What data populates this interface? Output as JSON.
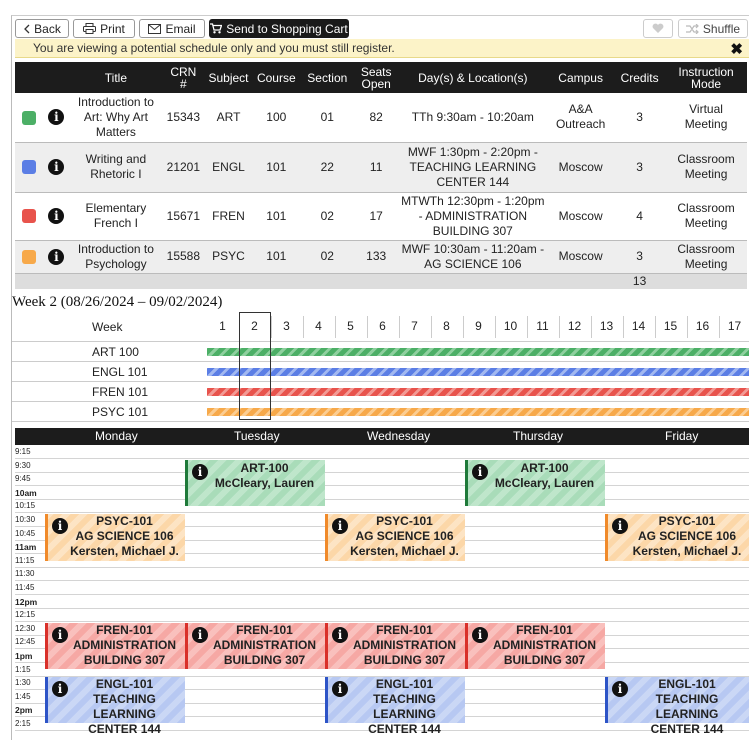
{
  "toolbar": {
    "back": "Back",
    "print": "Print",
    "email": "Email",
    "cart": "Send to Shopping Cart",
    "shuffle": "Shuffle",
    "icons": {
      "back": "chevron-left-icon",
      "print": "printer-icon",
      "email": "envelope-icon",
      "cart": "cart-icon",
      "favorite": "heart-icon",
      "shuffle": "shuffle-icon"
    }
  },
  "notice": {
    "text": "You are viewing a potential schedule only and you must still register.",
    "close": "✖"
  },
  "table": {
    "headers": {
      "title": "Title",
      "crn_a": "CRN",
      "crn_b": "#",
      "subject": "Subject",
      "course": "Course",
      "section": "Section",
      "seats_a": "Seats",
      "seats_b": "Open",
      "days": "Day(s) & Location(s)",
      "campus": "Campus",
      "credits": "Credits",
      "mode_a": "Instruction",
      "mode_b": "Mode"
    },
    "rows": [
      {
        "color": "#4caf66",
        "title": "Introduction to Art: Why Art Matters",
        "crn": "15343",
        "subject": "ART",
        "course": "100",
        "section": "01",
        "seats": "82",
        "days": "TTh 9:30am - 10:20am",
        "campus": "A&A Outreach",
        "credits": "3",
        "mode": "Virtual Meeting"
      },
      {
        "color": "#5b7ee5",
        "title": "Writing and Rhetoric I",
        "crn": "21201",
        "subject": "ENGL",
        "course": "101",
        "section": "22",
        "seats": "11",
        "days": "MWF 1:30pm - 2:20pm - TEACHING LEARNING CENTER 144",
        "campus": "Moscow",
        "credits": "3",
        "mode": "Classroom Meeting"
      },
      {
        "color": "#e8534c",
        "title": "Elementary French I",
        "crn": "15671",
        "subject": "FREN",
        "course": "101",
        "section": "02",
        "seats": "17",
        "days": "MTWTh 12:30pm - 1:20pm - ADMINISTRATION BUILDING 307",
        "campus": "Moscow",
        "credits": "4",
        "mode": "Classroom Meeting"
      },
      {
        "color": "#f7a94a",
        "title": "Introduction to Psychology",
        "crn": "15588",
        "subject": "PSYC",
        "course": "101",
        "section": "02",
        "seats": "133",
        "days": "MWF 10:30am - 11:20am - AG SCIENCE 106",
        "campus": "Moscow",
        "credits": "3",
        "mode": "Classroom Meeting"
      }
    ],
    "total_credits": "13",
    "info_glyph": "i"
  },
  "week_view": {
    "heading": "Week 2 (08/26/2024 – 09/02/2024)",
    "week_label": "Week",
    "weeks": [
      "1",
      "2",
      "3",
      "4",
      "5",
      "6",
      "7",
      "8",
      "9",
      "10",
      "11",
      "12",
      "13",
      "14",
      "15",
      "16",
      "17"
    ],
    "selected_week": "2",
    "courses": [
      {
        "label": "ART 100",
        "color": "#4caf66"
      },
      {
        "label": "ENGL 101",
        "color": "#5b7ee5"
      },
      {
        "label": "FREN 101",
        "color": "#e8534c"
      },
      {
        "label": "PSYC 101",
        "color": "#f7a94a"
      }
    ]
  },
  "calendar": {
    "days": [
      "Monday",
      "Tuesday",
      "Wednesday",
      "Thursday",
      "Friday"
    ],
    "times": [
      "9:15",
      "9:30",
      "9:45",
      "10am",
      "10:15",
      "10:30",
      "10:45",
      "11am",
      "11:15",
      "11:30",
      "11:45",
      "12pm",
      "12:15",
      "12:30",
      "12:45",
      "1pm",
      "1:15",
      "1:30",
      "1:45",
      "2pm",
      "2:15"
    ],
    "events": {
      "art": {
        "line1": "ART-100",
        "line2": "McCleary, Lauren"
      },
      "psyc": {
        "line1": "PSYC-101",
        "line2": "AG SCIENCE 106",
        "line3": "Kersten, Michael J."
      },
      "fren": {
        "line1": "FREN-101",
        "line2": "ADMINISTRATION",
        "line3": "BUILDING 307"
      },
      "engl": {
        "line1": "ENGL-101",
        "line2": "TEACHING LEARNING",
        "line3": "CENTER 144"
      }
    }
  }
}
